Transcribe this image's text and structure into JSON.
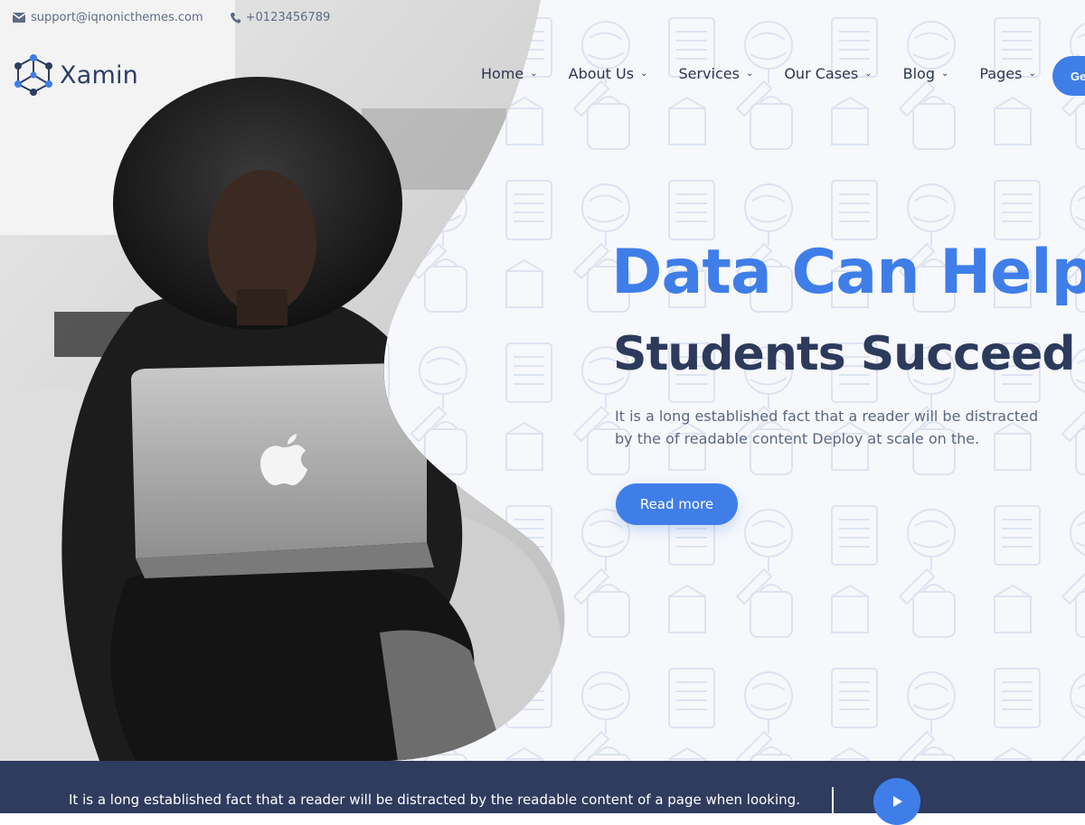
{
  "topbar": {
    "email": "support@iqnonicthemes.com",
    "phone": "+0123456789"
  },
  "brand": {
    "name": "Xamin"
  },
  "nav": {
    "items": [
      {
        "label": "Home"
      },
      {
        "label": "About Us"
      },
      {
        "label": "Services"
      },
      {
        "label": "Our Cases"
      },
      {
        "label": "Blog"
      },
      {
        "label": "Pages"
      }
    ],
    "cta_label": "Ge"
  },
  "hero": {
    "headline_primary": "Data Can Help",
    "headline_secondary": "Students Succeed",
    "lead": "It is a long established fact that a reader will be distracted by the of readable content Deploy at scale on the.",
    "button_label": "Read more"
  },
  "footer_bar": {
    "text": "It is a long established fact that a reader will be distracted by the readable content of a page when looking."
  },
  "colors": {
    "accent": "#3f7ee8",
    "heading_dark": "#2c3a5c",
    "bar_bg": "#2f3c5e",
    "text_muted": "#5b6680"
  },
  "icons": {
    "email": "envelope-icon",
    "phone": "phone-icon",
    "logo": "hexagon-network-icon",
    "play": "play-icon",
    "chevron": "chevron-down-icon"
  }
}
